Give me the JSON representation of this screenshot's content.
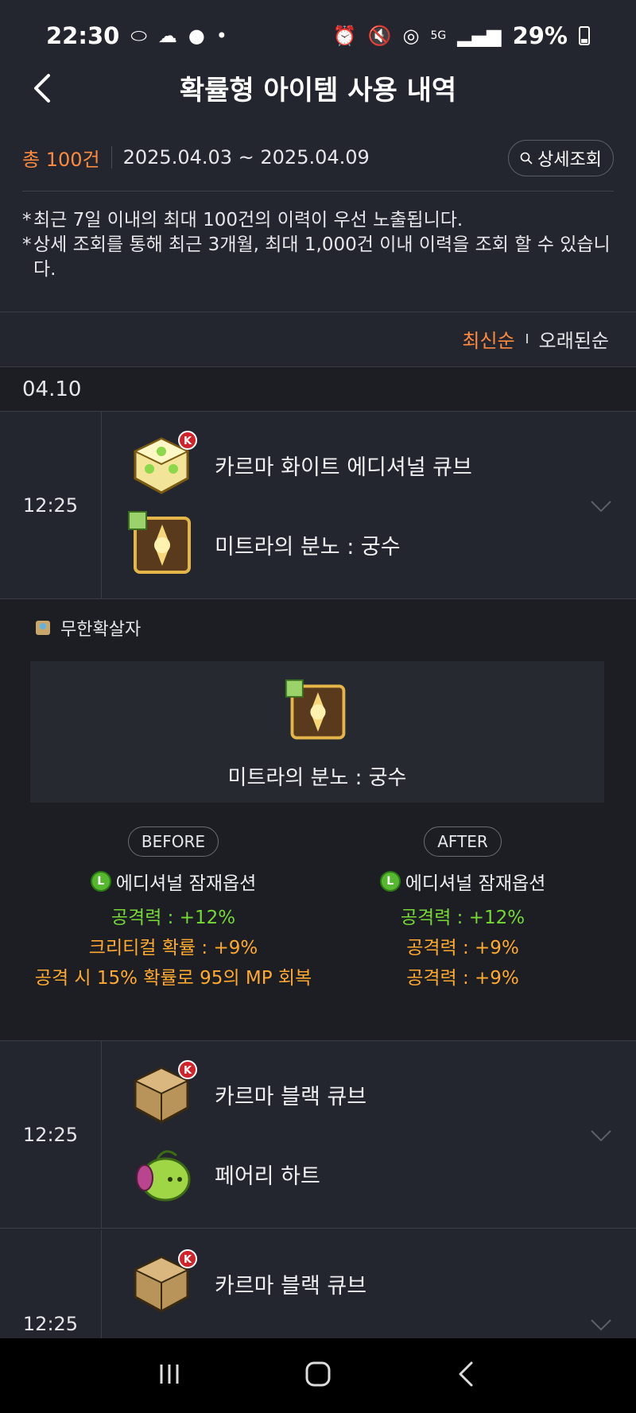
{
  "status_bar": {
    "time": "22:30",
    "battery": "29%",
    "left_icons": [
      "pill-icon",
      "cloud-icon",
      "reddit-icon",
      "dot-icon"
    ],
    "right_icons": [
      "alarm-icon",
      "mute-icon",
      "hotspot-icon",
      "5g-icon",
      "signal-icon",
      "battery-icon"
    ]
  },
  "header": {
    "title": "확률형 아이템 사용 내역"
  },
  "summary": {
    "total": "총 100건",
    "date_range": "2025.04.03 ~ 2025.04.09",
    "detail_button": "상세조회"
  },
  "notes": [
    "최근 7일 이내의 최대 100건의 이력이 우선 노출됩니다.",
    "상세 조회를 통해 최근 3개월, 최대 1,000건 이내 이력을 조회 할 수 있습니다."
  ],
  "note_marker": "*",
  "sort": {
    "newest": "최신순",
    "oldest": "오래된순"
  },
  "date_header": "04.10",
  "entries": [
    {
      "time": "12:25",
      "item1": "카르마 화이트 에디셔널 큐브",
      "item2": "미트라의 분노 : 궁수"
    },
    {
      "time": "12:25",
      "item1": "카르마 블랙 큐브",
      "item2": "페어리 하트"
    },
    {
      "time": "12:25",
      "item1": "카르마 블랙 큐브",
      "item2": ""
    }
  ],
  "detail": {
    "character": "무한확살자",
    "item_name": "미트라의 분노 : 궁수",
    "before_label": "BEFORE",
    "after_label": "AFTER",
    "option_badge": "L",
    "option_title": "에디셔널 잠재옵션",
    "before": [
      "공격력 : +12%",
      "크리티컬 확률 : +9%",
      "공격 시 15% 확률로 95의 MP 회복"
    ],
    "after": [
      "공격력 : +12%",
      "공격력 : +9%",
      "공격력 : +9%"
    ]
  },
  "colors": {
    "accent_orange": "#ff8a3d",
    "option_green": "#76d936",
    "option_orange": "#ffa92e",
    "background": "#23262e"
  },
  "nav": [
    "recent-apps-icon",
    "home-icon",
    "back-icon"
  ]
}
